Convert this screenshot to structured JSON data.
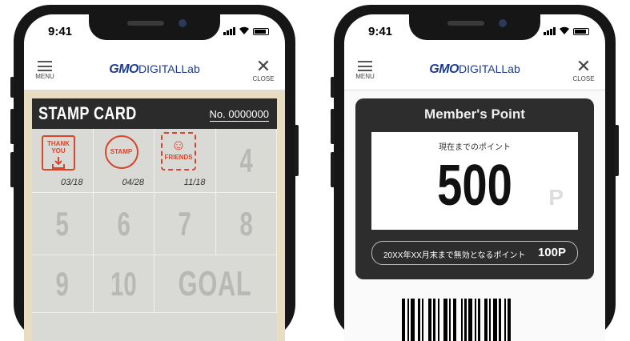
{
  "left_phone": {
    "status": {
      "time": "9:41"
    },
    "header": {
      "menu_label": "MENU",
      "logo_bold": "GMO",
      "logo_rest": "DIGITALLab",
      "close_label": "CLOSE"
    },
    "card": {
      "title": "STAMP CARD",
      "number": "No. 0000000",
      "stamps": [
        {
          "text": "THANK YOU",
          "date": "03/18"
        },
        {
          "text": "STAMP",
          "date": "04/28"
        },
        {
          "text": "FRIENDS",
          "date": "11/18"
        }
      ],
      "numbers": [
        "4",
        "5",
        "6",
        "7",
        "8",
        "9",
        "10"
      ],
      "goal": "GOAL"
    }
  },
  "right_phone": {
    "status": {
      "time": "9:41"
    },
    "header": {
      "menu_label": "MENU",
      "logo_bold": "GMO",
      "logo_rest": "DIGITALLab",
      "close_label": "CLOSE"
    },
    "point_card": {
      "title": "Member's Point",
      "subtitle": "現在までのポイント",
      "points": "500",
      "unit": "P",
      "expire_text": "20XX年XX月末まで無効となるポイント",
      "expire_value": "100P"
    }
  },
  "colors": {
    "accent_red": "#d8452b",
    "brand_blue": "#1c3b8f",
    "card_dark": "#2d2d2d"
  }
}
